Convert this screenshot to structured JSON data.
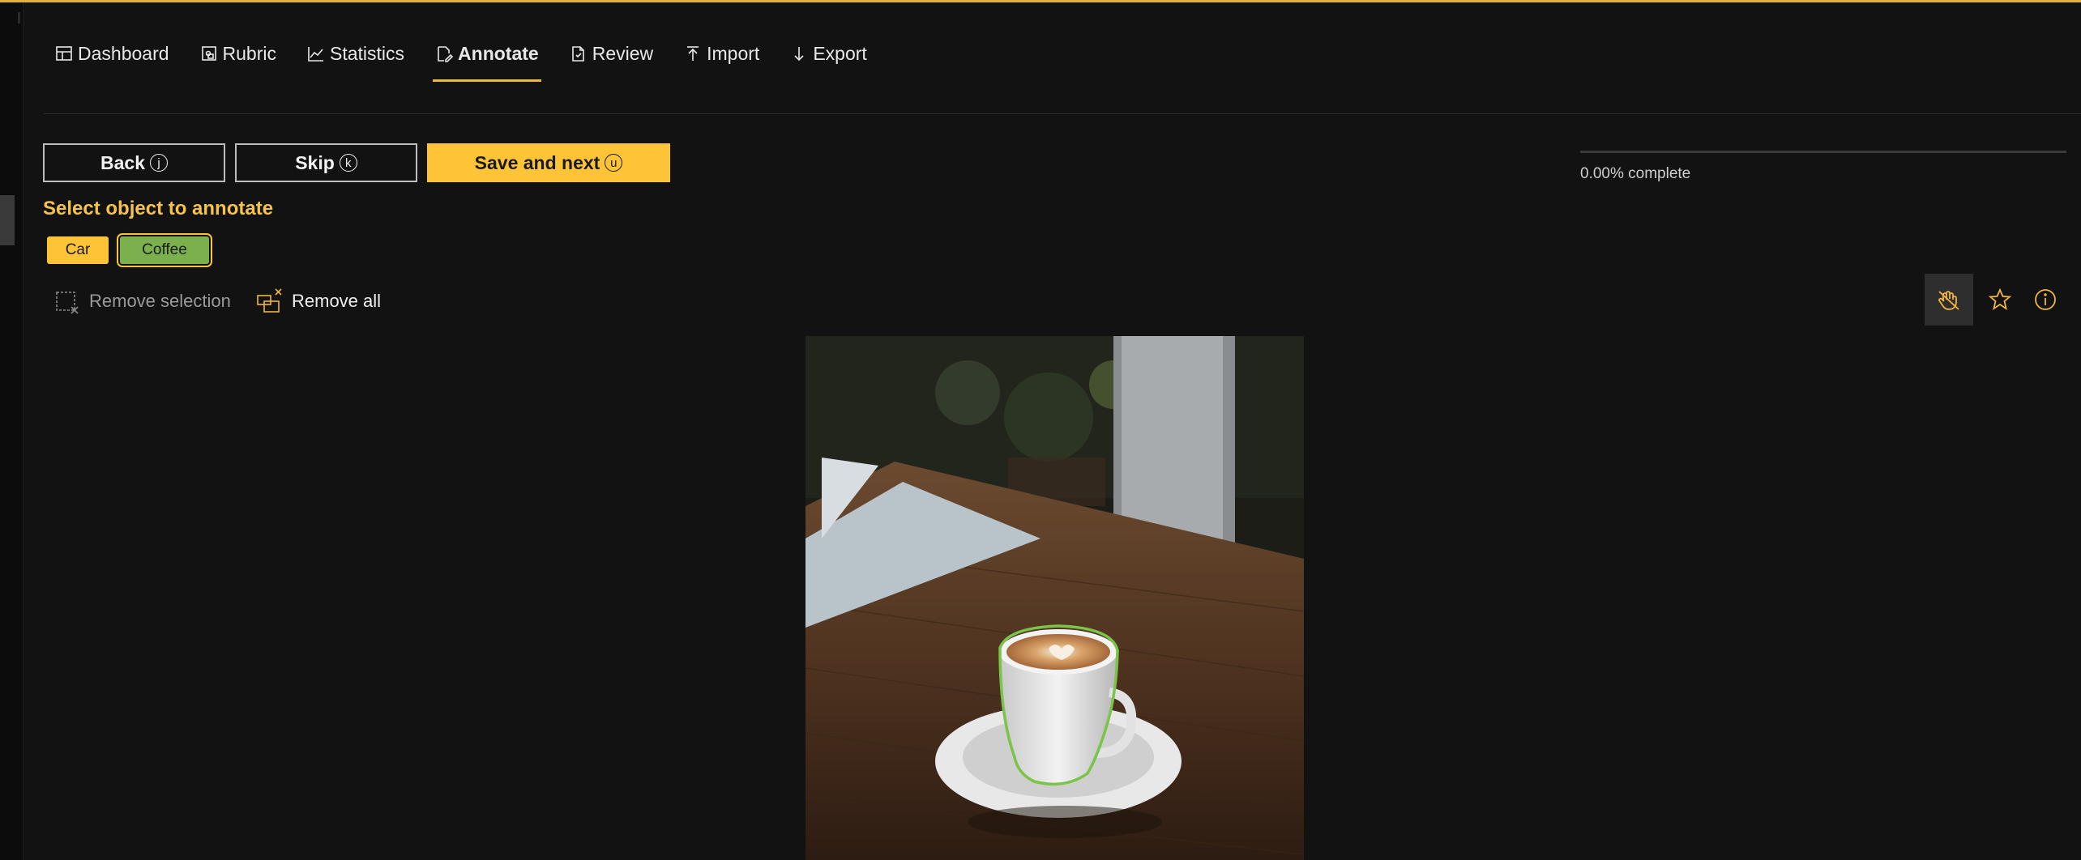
{
  "nav": {
    "items": [
      {
        "label": "Dashboard",
        "icon": "dashboard-icon"
      },
      {
        "label": "Rubric",
        "icon": "rubric-icon"
      },
      {
        "label": "Statistics",
        "icon": "statistics-icon"
      },
      {
        "label": "Annotate",
        "icon": "annotate-icon",
        "active": true
      },
      {
        "label": "Review",
        "icon": "review-icon"
      },
      {
        "label": "Import",
        "icon": "import-icon"
      },
      {
        "label": "Export",
        "icon": "export-icon"
      }
    ]
  },
  "actions": {
    "back_label": "Back",
    "back_key": "j",
    "skip_label": "Skip",
    "skip_key": "k",
    "save_label": "Save and next",
    "save_key": "u"
  },
  "progress": {
    "fraction": 0.0,
    "text": "0.00% complete"
  },
  "objects": {
    "heading": "Select object to annotate",
    "items": [
      {
        "label": "Car",
        "color": "#fcc436"
      },
      {
        "label": "Coffee",
        "color": "#7bb04c",
        "selected": true
      }
    ]
  },
  "tools": {
    "remove_selection": "Remove selection",
    "remove_all": "Remove all",
    "right_icons": [
      "pan-hand-icon",
      "star-icon",
      "info-icon"
    ]
  },
  "canvas": {
    "image": "coffee-cup-on-wooden-table",
    "annotation_color": "#7bc44a"
  },
  "colors": {
    "accent": "#fcc436",
    "background": "#121212"
  }
}
